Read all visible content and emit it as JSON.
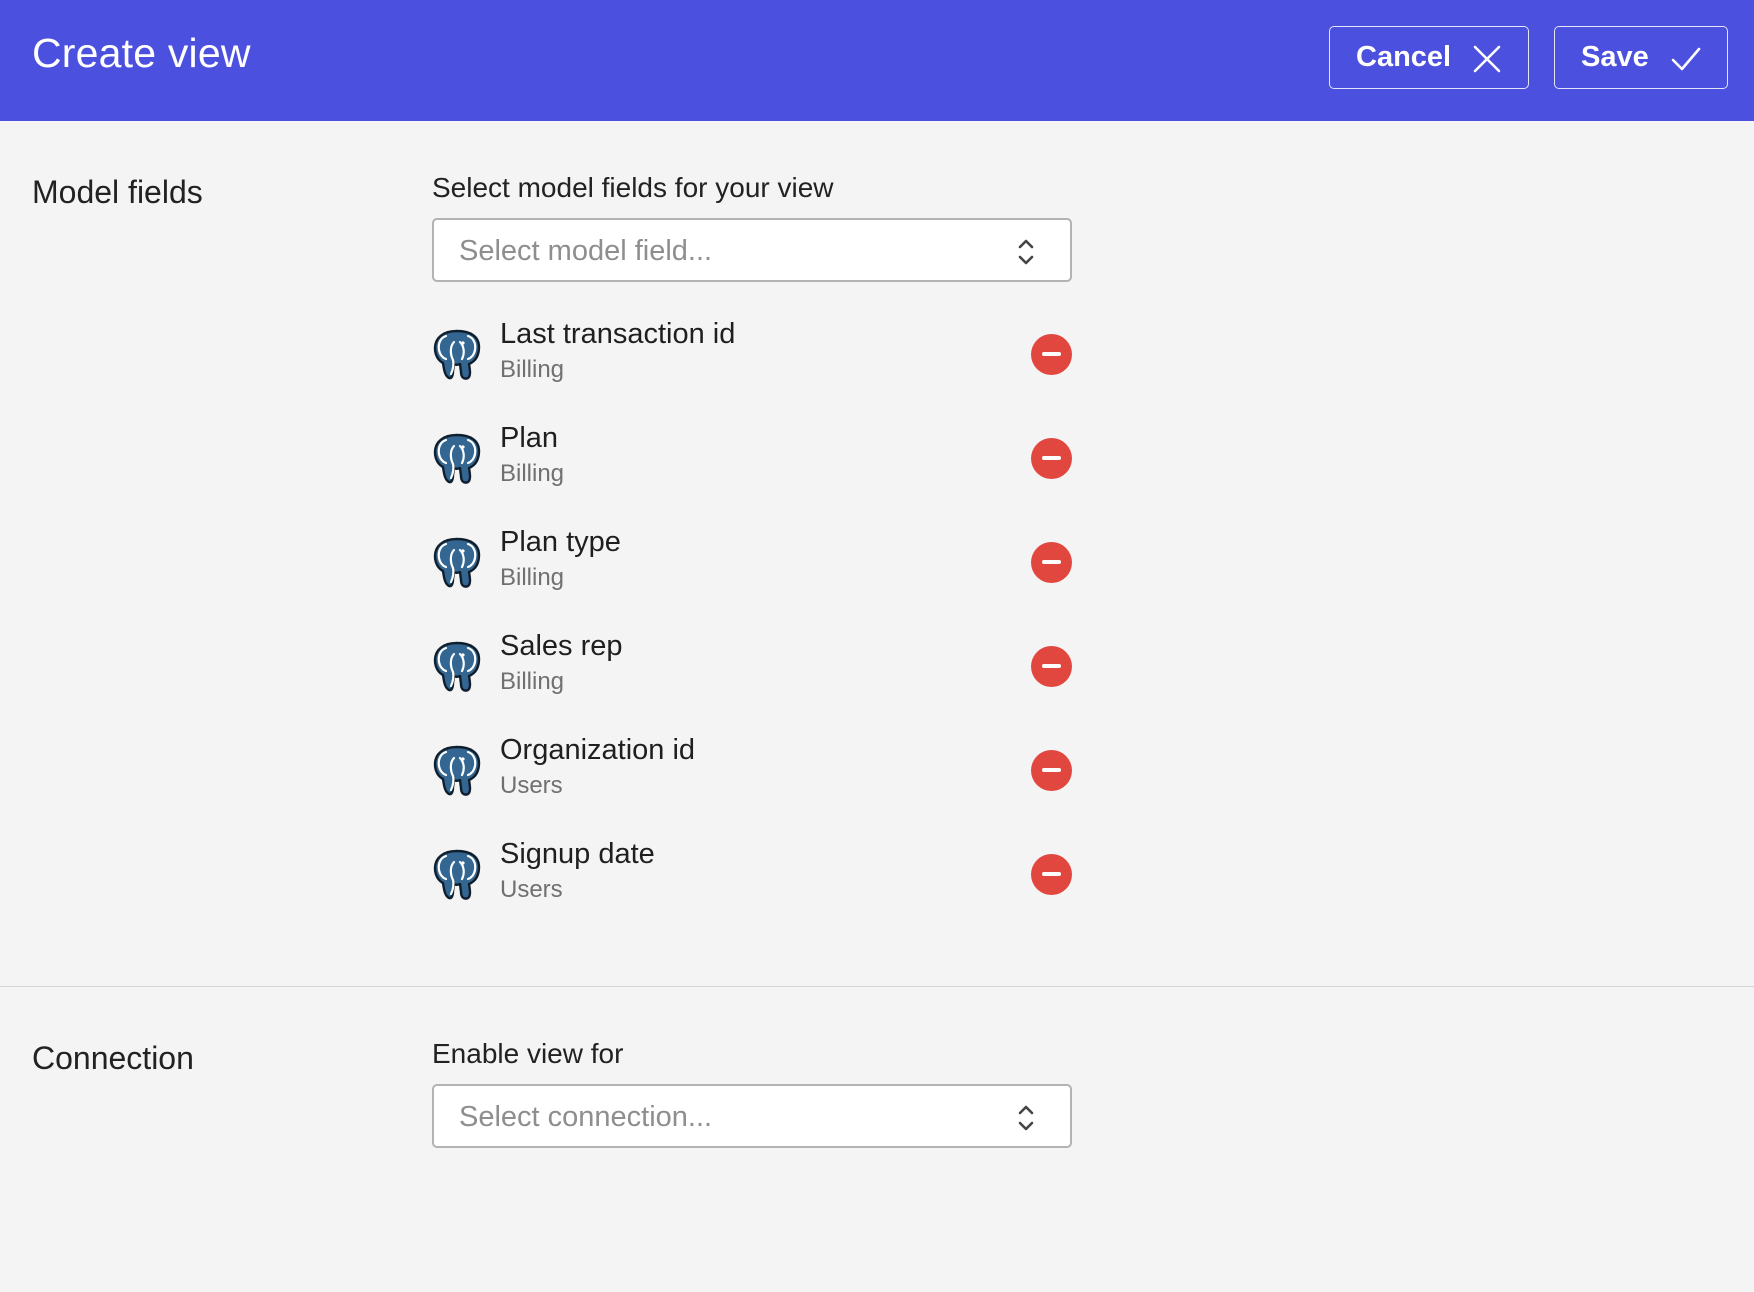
{
  "header": {
    "title": "Create view",
    "cancel_label": "Cancel",
    "save_label": "Save",
    "background": "#4b50de"
  },
  "model_fields": {
    "section_title": "Model fields",
    "select_label": "Select model fields for your view",
    "select_placeholder": "Select model field...",
    "items": [
      {
        "name": "Last transaction id",
        "group": "Billing",
        "icon": "postgresql-icon"
      },
      {
        "name": "Plan",
        "group": "Billing",
        "icon": "postgresql-icon"
      },
      {
        "name": "Plan type",
        "group": "Billing",
        "icon": "postgresql-icon"
      },
      {
        "name": "Sales rep",
        "group": "Billing",
        "icon": "postgresql-icon"
      },
      {
        "name": "Organization id",
        "group": "Users",
        "icon": "postgresql-icon"
      },
      {
        "name": "Signup date",
        "group": "Users",
        "icon": "postgresql-icon"
      }
    ]
  },
  "connection": {
    "section_title": "Connection",
    "select_label": "Enable view for",
    "select_placeholder": "Select connection..."
  },
  "colors": {
    "remove": "#e2473f",
    "elephant": "#336791"
  }
}
